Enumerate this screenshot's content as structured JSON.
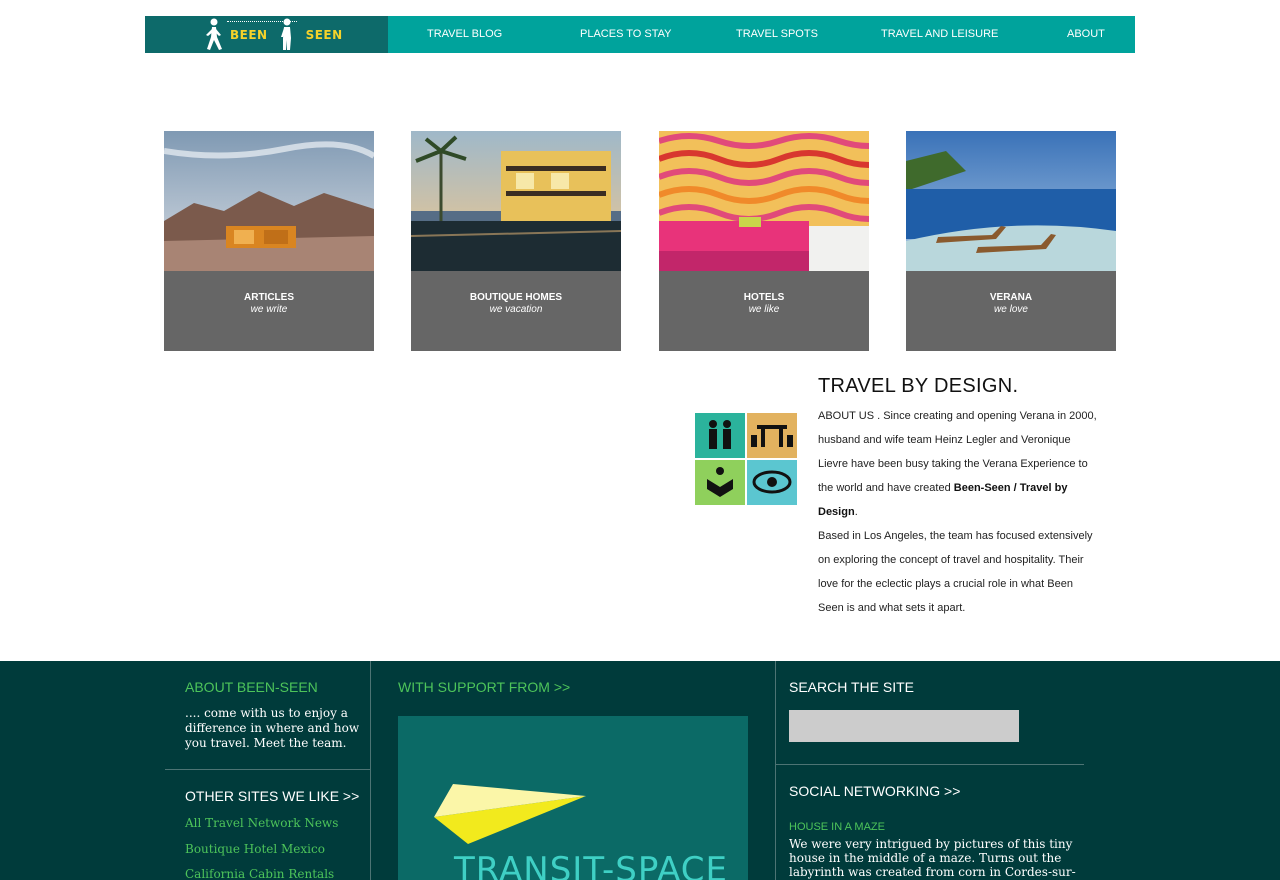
{
  "logo": {
    "word_left": "BEEN",
    "word_right": "SEEN"
  },
  "nav": [
    {
      "label": "TRAVEL BLOG"
    },
    {
      "label": "PLACES TO STAY"
    },
    {
      "label": "TRAVEL SPOTS"
    },
    {
      "label": "TRAVEL AND LEISURE"
    },
    {
      "label": "ABOUT"
    }
  ],
  "cards": [
    {
      "title": "ARTICLES",
      "subtitle": "we write",
      "image": "desert-house-photo"
    },
    {
      "title": "BOUTIQUE HOMES",
      "subtitle": "we vacation",
      "image": "pool-villa-photo"
    },
    {
      "title": "HOTELS",
      "subtitle": "we like",
      "image": "swirl-hotel-room-photo"
    },
    {
      "title": "VERANA",
      "subtitle": "we love",
      "image": "ocean-loungers-photo"
    }
  ],
  "about": {
    "title": "TRAVEL BY DESIGN.",
    "p1_start": "ABOUT US . Since creating and opening Verana in 2000, husband and wife team Heinz Legler and Veronique Lievre have been busy taking the Verana Experience to the world and have created ",
    "p1_bold": "Been-Seen / Travel by Design",
    "p1_end": ".",
    "p2": "Based in Los Angeles, the team has focused extensively on exploring the concept of travel and hospitality. Their love for the eclectic plays a crucial role in what Been Seen is and what sets it apart."
  },
  "footer": {
    "about_heading": "ABOUT BEEN-SEEN",
    "about_blurb": ".... come with us to enjoy a difference in where and how you travel. Meet the team.",
    "other_heading": "OTHER SITES WE LIKE >>",
    "other_links": [
      "All Travel Network News",
      "Boutique Hotel Mexico",
      "California Cabin Rentals"
    ],
    "support_heading": "WITH SUPPORT FROM >>",
    "sponsor_name": "TRANSIT-SPACE",
    "search_heading": "SEARCH THE SITE",
    "search_value": "",
    "social_heading": "SOCIAL NETWORKING >>",
    "news_title": "HOUSE IN A MAZE",
    "news_text": "We were very intrigued by pictures of this tiny house in the middle of a maze. Turns out the labyrinth was created from corn in Cordes-sur-"
  },
  "colors": {
    "nav_bg": "#00a39c",
    "logo_bg": "#0d6a6a",
    "logo_text": "#f5d22a",
    "card_caption_bg": "#666666",
    "footer_bg": "#003b3b",
    "footer_accent": "#4dc45a"
  }
}
